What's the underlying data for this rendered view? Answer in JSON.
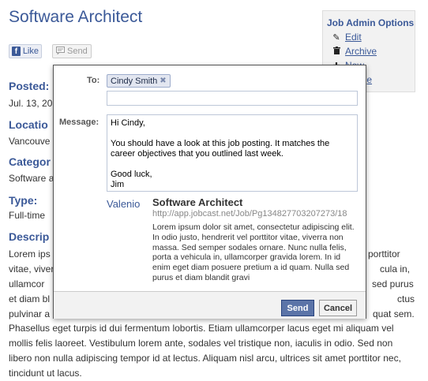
{
  "page": {
    "title": "Software Architect",
    "like_label": "Like",
    "send_label": "Send",
    "posted_label": "Posted:",
    "posted_value": "Jul. 13, 20",
    "location_label": "Locatio",
    "location_value": "Vancouve",
    "category_label": "Categor",
    "category_value": "Software a",
    "type_label": "Type:",
    "type_value": "Full-time",
    "description_label": "Descrip",
    "desc_lines": [
      "Lorem ips",
      "vitae, viver",
      "ullamcor",
      "et diam bl",
      "pulvinar a"
    ],
    "desc_right_lines": [
      "porttitor",
      "cula in,",
      "sed purus",
      "ctus",
      "quat sem."
    ],
    "desc_full_lines": [
      "Phasellus eget turpis id dui fermentum lobortis. Etiam ullamcorper lacus eget mi aliquam vel",
      "mollis felis laoreet. Vestibulum lorem ante, sodales vel tristique non, iaculis in odio. Sed non",
      "libero non nulla adipiscing tempor id at lectus. Aliquam nisl arcu, ultrices sit amet porttitor nec,",
      "tincidunt ut lacus."
    ]
  },
  "admin": {
    "title": "Job Admin Options",
    "edit": "Edit",
    "archive": "Archive",
    "new": "New",
    "manage": "age"
  },
  "dialog": {
    "to_label": "To:",
    "recipient": "Cindy Smith",
    "message_label": "Message:",
    "message_paragraphs": [
      "Hi Cindy,",
      "You should have a look at this job posting. It matches the career objectives that you outlined last week.",
      "Good luck,\nJim"
    ],
    "site_name": "Valenio",
    "job_title": "Software Architect",
    "job_url": "http://app.jobcast.net/Job/Pg134827703207273/18",
    "job_desc": "Lorem ipsum dolor sit amet, consectetur adipiscing elit. In odio justo, hendrerit vel porttitor vitae, viverra non massa. Sed semper sodales ornare. Nunc nulla felis, porta a vehicula in, ullamcorper gravida lorem. In id enim eget diam posuere pretium a id quam. Nulla sed purus et diam blandit gravi",
    "send_button": "Send",
    "cancel_button": "Cancel"
  }
}
